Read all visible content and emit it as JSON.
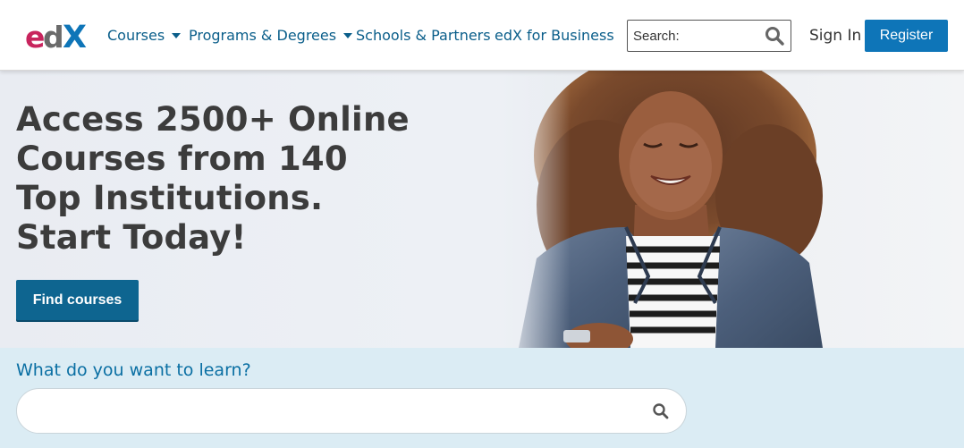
{
  "header": {
    "logo_text": "edX",
    "nav": [
      {
        "label": "Courses",
        "has_caret": true
      },
      {
        "label": "Programs & Degrees",
        "has_caret": true
      },
      {
        "label": "Schools & Partners",
        "has_caret": false
      },
      {
        "label": "edX for Business",
        "has_caret": false
      }
    ],
    "search": {
      "placeholder": "Search:",
      "value": "",
      "icon": "search-icon"
    },
    "sign_in": "Sign In",
    "register": "Register"
  },
  "hero": {
    "title_lines": [
      "Access 2500+ Online",
      "Courses from 140",
      "Top Institutions.",
      "Start Today!"
    ],
    "cta": "Find courses"
  },
  "learn": {
    "label": "What do you want to learn?",
    "placeholder": "",
    "value": "",
    "icon": "search-icon"
  },
  "colors": {
    "brand_blue": "#0e75b8",
    "nav_text": "#0a5e8a",
    "cta_blue": "#0e6590",
    "learn_band": "#dbecf4",
    "logo_pink": "#c8245d",
    "logo_gray": "#6a6a6a",
    "logo_blue": "#0e75b8"
  }
}
